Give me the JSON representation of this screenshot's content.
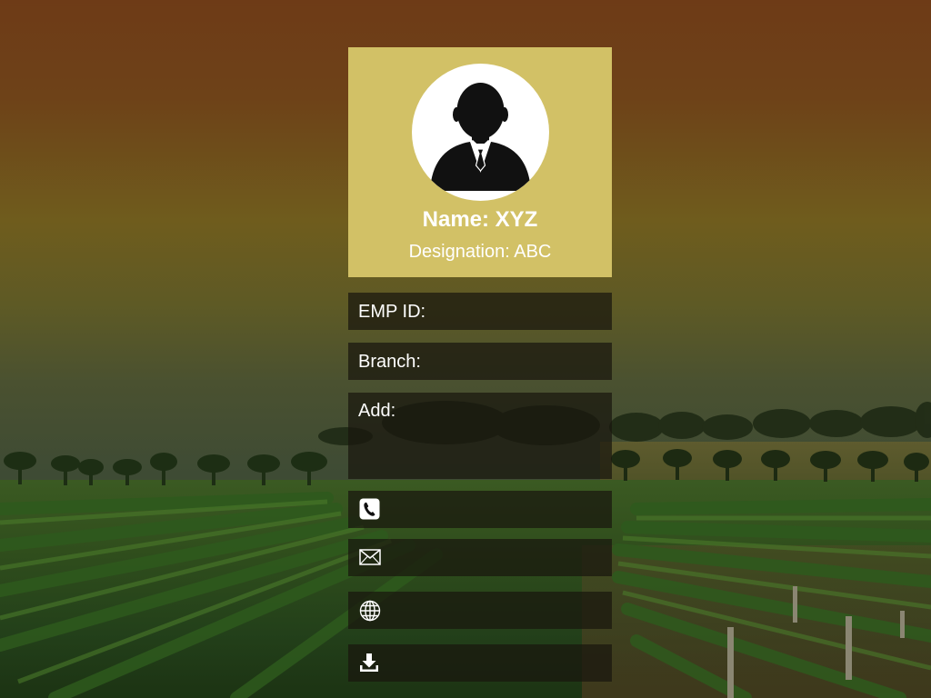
{
  "profile": {
    "avatar_icon": "businessman-avatar-icon",
    "name": "Name: XYZ",
    "designation": "Designation: ABC",
    "card_color": "#d2c166"
  },
  "fields": {
    "emp_id_label": "EMP ID:",
    "branch_label": "Branch:",
    "address_label": "Add:"
  },
  "actions": [
    {
      "icon": "phone-icon"
    },
    {
      "icon": "mail-icon"
    },
    {
      "icon": "globe-icon"
    },
    {
      "icon": "download-icon"
    }
  ]
}
